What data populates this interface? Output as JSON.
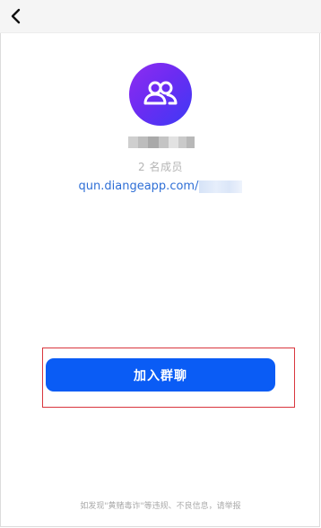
{
  "header": {
    "back_icon": "chevron-left-icon"
  },
  "group": {
    "avatar_icon": "group-users-icon",
    "avatar_gradient": [
      "#8e2df0",
      "#3d3af5"
    ],
    "member_count": "2 名成员",
    "link_text": "qun.diangeapp.com/"
  },
  "actions": {
    "join_label": "加入群聊",
    "join_color": "#0a5cf5",
    "highlight_color": "#d9363e"
  },
  "footer": {
    "report_text": "如发现\"黄赌毒诈\"等违规、不良信息，请举报"
  }
}
